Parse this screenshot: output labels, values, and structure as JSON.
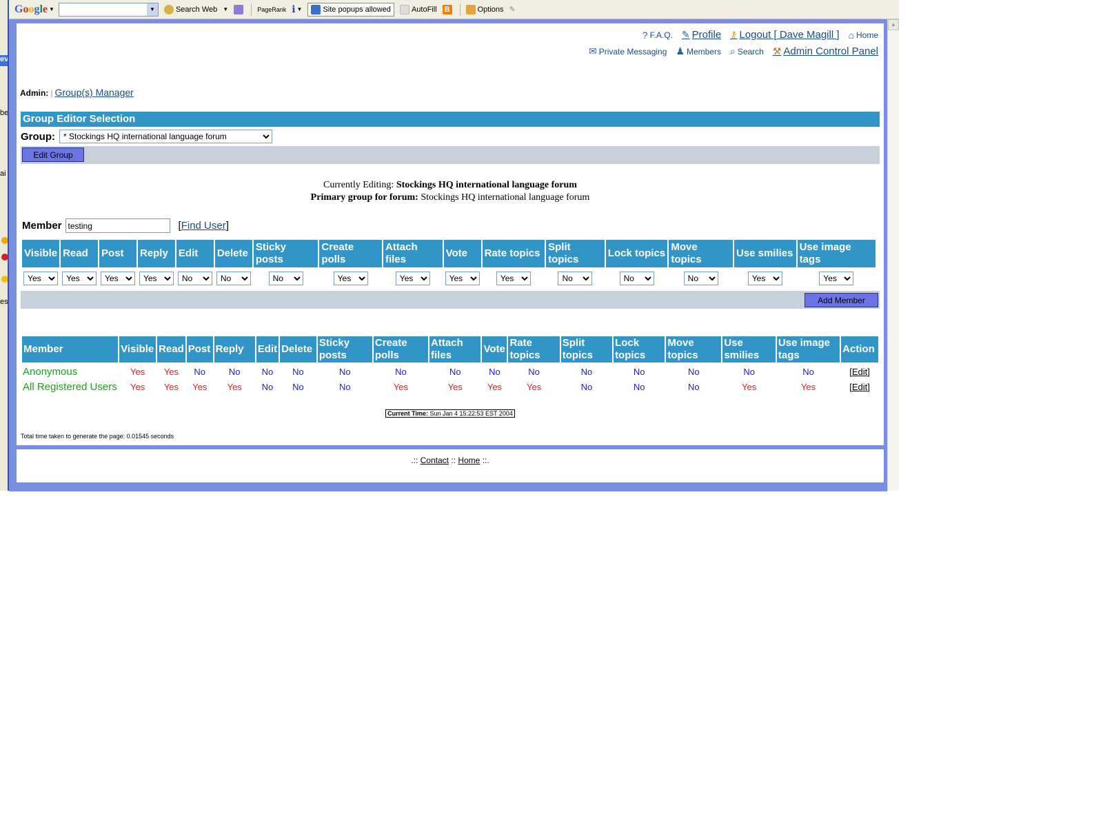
{
  "behind": {
    "title_fragment": "ev",
    "frag1": "ai",
    "frag2": "be",
    "frag3": "es"
  },
  "toolbar": {
    "logo": [
      "G",
      "o",
      "o",
      "g",
      "l",
      "e"
    ],
    "search_web": "Search Web",
    "pagerank": "PageRank",
    "popups": "Site popups allowed",
    "autofill": "AutoFill",
    "options": "Options"
  },
  "nav": {
    "faq": "F.A.Q.",
    "profile": "Profile",
    "logout": "Logout [ Dave Magill ]",
    "home": "Home",
    "pm": "Private Messaging",
    "members": "Members",
    "search": "Search",
    "acp": "Admin Control Panel"
  },
  "crumb": {
    "admin": "Admin:",
    "pipe": "|",
    "link": "Group(s) Manager"
  },
  "group_editor": {
    "title": "Group Editor Selection",
    "group_label": "Group:",
    "group_selected": "* Stockings HQ international language forum",
    "edit_button": "Edit Group"
  },
  "editing": {
    "label1": "Currently Editing:",
    "value1": "Stockings HQ international language forum",
    "label2": "Primary group for forum:",
    "value2": "Stockings HQ international language forum"
  },
  "member_add": {
    "label": "Member",
    "value": "testing",
    "find_open": "[",
    "find_link": "Find User",
    "find_close": "]",
    "add_button": "Add Member"
  },
  "perm_headers": [
    "Visible",
    "Read",
    "Post",
    "Reply",
    "Edit",
    "Delete",
    "Sticky posts",
    "Create polls",
    "Attach files",
    "Vote",
    "Rate topics",
    "Split topics",
    "Lock topics",
    "Move topics",
    "Use smilies",
    "Use image tags"
  ],
  "perm_defaults": [
    "Yes",
    "Yes",
    "Yes",
    "Yes",
    "No",
    "No",
    "No",
    "Yes",
    "Yes",
    "Yes",
    "Yes",
    "No",
    "No",
    "No",
    "Yes",
    "Yes"
  ],
  "list_headers": [
    "Member",
    "Visible",
    "Read",
    "Post",
    "Reply",
    "Edit",
    "Delete",
    "Sticky posts",
    "Create polls",
    "Attach files",
    "Vote",
    "Rate topics",
    "Split topics",
    "Lock topics",
    "Move topics",
    "Use smilies",
    "Use image tags",
    "Action"
  ],
  "list_rows": [
    {
      "name": "Anonymous",
      "perms": [
        "Yes",
        "Yes",
        "No",
        "No",
        "No",
        "No",
        "No",
        "No",
        "No",
        "No",
        "No",
        "No",
        "No",
        "No",
        "No",
        "No"
      ],
      "action": "Edit"
    },
    {
      "name": "All Registered Users",
      "perms": [
        "Yes",
        "Yes",
        "Yes",
        "Yes",
        "No",
        "No",
        "No",
        "Yes",
        "Yes",
        "Yes",
        "Yes",
        "No",
        "No",
        "No",
        "Yes",
        "Yes"
      ],
      "action": "Edit"
    }
  ],
  "current_time": {
    "label": "Current Time:",
    "value": "Sun Jan 4 15:22:53 EST 2004"
  },
  "gen_time": "Total time taken to generate the page: 0.01545 seconds",
  "footer": {
    "pre": ".:: ",
    "contact": "Contact",
    "mid": " :: ",
    "home": "Home",
    "post": " ::."
  },
  "colors": {
    "header_bar": "#3195c8",
    "frame": "#7a8fe0",
    "button": "#6a74e4",
    "yes": "#e81b1b",
    "no": "#1b1bd4",
    "member_name": "#1aa21a"
  }
}
